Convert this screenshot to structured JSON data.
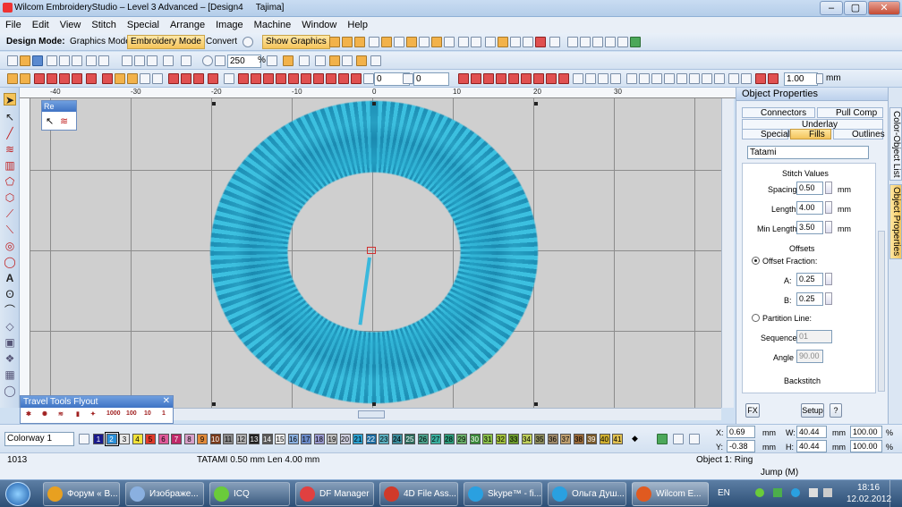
{
  "window": {
    "title": "Wilcom EmbroideryStudio – Level 3 Advanced – [Design4",
    "title_suffix": "Tajima]"
  },
  "menu": [
    "File",
    "Edit",
    "View",
    "Stitch",
    "Special",
    "Arrange",
    "Image",
    "Machine",
    "Window",
    "Help"
  ],
  "toolbar": {
    "design_mode_label": "Design Mode:",
    "graphics_mode": "Graphics Mode",
    "embroidery_mode": "Embroidery Mode",
    "convert": "Convert",
    "show_graphics": "Show Graphics",
    "zoom_value": "250",
    "zoom_unit": "%",
    "field_a": "0",
    "field_b": "0",
    "width_value": "1.00",
    "width_unit": "mm"
  },
  "ruler": {
    "h_ticks": [
      "-40",
      "-30",
      "-20",
      "-10",
      "0",
      "10",
      "20",
      "30"
    ]
  },
  "re_flyout": {
    "title": "Re"
  },
  "travel_flyout": {
    "title": "Travel Tools Flyout",
    "items": [
      "1000",
      "100",
      "10",
      "1"
    ]
  },
  "object_properties": {
    "title": "Object Properties",
    "tabs": [
      "Connectors",
      "Pull Comp",
      "Underlay",
      "Special",
      "Fills",
      "Outlines"
    ],
    "fill_type": "Tatami",
    "stitch_values_heading": "Stitch Values",
    "spacing_label": "Spacing",
    "spacing_value": "0.50",
    "length_label": "Length",
    "length_value": "4.00",
    "min_length_label": "Min Length",
    "min_length_value": "3.50",
    "unit": "mm",
    "offsets_heading": "Offsets",
    "offset_fraction_label": "Offset Fraction:",
    "a_label": "A:",
    "a_value": "0.25",
    "b_label": "B:",
    "b_value": "0.25",
    "partition_line_label": "Partition Line:",
    "sequence_label": "Sequence",
    "sequence_value": "01",
    "angle_label": "Angle",
    "angle_value": "90.00",
    "backstitch_heading": "Backstitch",
    "fx_button": "FX",
    "setup_button": "Setup",
    "help_button": "?"
  },
  "side_tabs": [
    "Color-Object List",
    "Object Properties"
  ],
  "colorbar": {
    "colorway": "Colorway 1",
    "swatches": [
      {
        "n": "1",
        "c": "#1a1a8c"
      },
      {
        "n": "2",
        "c": "#2a8fd8"
      },
      {
        "n": "3",
        "c": "#e8e8e8"
      },
      {
        "n": "4",
        "c": "#f2e23a"
      },
      {
        "n": "5",
        "c": "#e03a2a"
      },
      {
        "n": "6",
        "c": "#e05a9a"
      },
      {
        "n": "7",
        "c": "#c02a6a"
      },
      {
        "n": "8",
        "c": "#d8a0c8"
      },
      {
        "n": "9",
        "c": "#e08a3a"
      },
      {
        "n": "10",
        "c": "#7a3a1a"
      },
      {
        "n": "11",
        "c": "#8a8a8a"
      },
      {
        "n": "12",
        "c": "#b0b0b0"
      },
      {
        "n": "13",
        "c": "#202020"
      },
      {
        "n": "14",
        "c": "#5a5a5a"
      },
      {
        "n": "15",
        "c": "#f0f0f0"
      },
      {
        "n": "16",
        "c": "#8ab0e0"
      },
      {
        "n": "17",
        "c": "#6a8ac8"
      },
      {
        "n": "18",
        "c": "#9a9ad0"
      },
      {
        "n": "19",
        "c": "#c0c0c0"
      },
      {
        "n": "20",
        "c": "#d0d0e0"
      },
      {
        "n": "21",
        "c": "#2aa0d0"
      },
      {
        "n": "22",
        "c": "#1a6aa0"
      },
      {
        "n": "23",
        "c": "#5ab0c0"
      },
      {
        "n": "24",
        "c": "#3a8a9a"
      },
      {
        "n": "25",
        "c": "#2a6a5a"
      },
      {
        "n": "26",
        "c": "#4aa08a"
      },
      {
        "n": "27",
        "c": "#3ab0a0"
      },
      {
        "n": "28",
        "c": "#2a9a7a"
      },
      {
        "n": "29",
        "c": "#6ab06a"
      },
      {
        "n": "30",
        "c": "#3a8a3a"
      },
      {
        "n": "31",
        "c": "#8ac04a"
      },
      {
        "n": "32",
        "c": "#a0c03a"
      },
      {
        "n": "33",
        "c": "#6a9a2a"
      },
      {
        "n": "34",
        "c": "#c0d05a"
      },
      {
        "n": "35",
        "c": "#8a8a5a"
      },
      {
        "n": "36",
        "c": "#a08a6a"
      },
      {
        "n": "37",
        "c": "#c0a070"
      },
      {
        "n": "38",
        "c": "#9a6a3a"
      },
      {
        "n": "39",
        "c": "#7a5a2a"
      },
      {
        "n": "40",
        "c": "#d0b030"
      },
      {
        "n": "41",
        "c": "#e0c050"
      }
    ],
    "x_label": "X:",
    "x_value": "0.69",
    "y_label": "Y:",
    "y_value": "-0.38",
    "w_label": "W:",
    "w_value": "40.44",
    "h_label": "H:",
    "h_value": "40.44",
    "unit": "mm",
    "w_pct": "100.00",
    "h_pct": "100.00",
    "pct": "%"
  },
  "status": {
    "count": "1013",
    "info": "TATAMI  0.50 mm Len  4.00 mm",
    "object": "Object 1: Ring",
    "jump": "Jump (M)"
  },
  "taskbar": {
    "tasks": [
      "Форум « В...",
      "Изображе...",
      "ICQ",
      "DF Manager",
      "4D File Ass...",
      "Skype™ - fi...",
      "Ольга Душ...",
      "Wilcom E..."
    ],
    "lang": "EN",
    "time": "18:16",
    "date": "12.02.2012"
  },
  "colors": {
    "accent": "#f5c45a",
    "ring": "#2aa6cc"
  }
}
